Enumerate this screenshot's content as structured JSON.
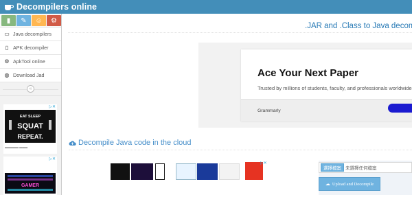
{
  "navbar": {
    "brand": "Decompilers online",
    "brand_icon": "coffee-cup-icon",
    "color": "#438eb9"
  },
  "sidebar": {
    "shortcuts": [
      {
        "name": "signal-icon",
        "glyph": "▮",
        "color": "#87b87f"
      },
      {
        "name": "pencil-icon",
        "glyph": "✎",
        "color": "#6fb3e0"
      },
      {
        "name": "users-icon",
        "glyph": "☺",
        "color": "#ffb752"
      },
      {
        "name": "cogs-icon",
        "glyph": "⚙",
        "color": "#d15b47"
      }
    ],
    "items": [
      {
        "label": "Java decompilers",
        "icon": "laptop-icon",
        "glyph": "▭"
      },
      {
        "label": "APK decompiler",
        "icon": "file-icon",
        "glyph": "▯"
      },
      {
        "label": "ApkTool online",
        "icon": "gear-icon",
        "glyph": "⚙"
      },
      {
        "label": "Download Jad",
        "icon": "globe-icon",
        "glyph": "◍"
      }
    ],
    "collapse_glyph": "«",
    "ad1": {
      "lines": [
        "EAT SLEEP",
        "SQUAT",
        "REPEAT."
      ]
    },
    "ad2": {
      "text": "GAMER"
    }
  },
  "main": {
    "page_title": ".JAR and .Class to Java decompiler",
    "ad": {
      "title": "Ace Your Next Paper",
      "subtitle": "Trusted by millions of students, faculty, and professionals worldwide.",
      "brand": "Grammarly",
      "button_color": "#1a1ad0"
    },
    "section_title": "Decompile Java code in the cloud",
    "upload": {
      "choose_label": "選擇檔案",
      "no_file_label": "未選擇任何檔案",
      "upload_label": "Upload and Decompile"
    }
  }
}
